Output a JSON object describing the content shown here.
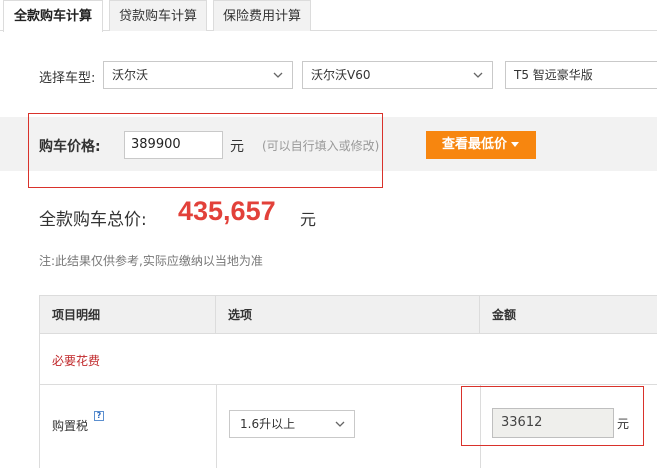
{
  "tabs": [
    {
      "label": "全款购车计算",
      "active": true
    },
    {
      "label": "贷款购车计算",
      "active": false
    },
    {
      "label": "保险费用计算",
      "active": false
    }
  ],
  "model_select": {
    "label": "选择车型:",
    "brand": "沃尔沃",
    "series": "沃尔沃V60",
    "trim": "T5 智远豪华版"
  },
  "price": {
    "label": "购车价格:",
    "value": "389900",
    "unit": "元",
    "hint": "(可以自行填入或修改)",
    "button_label": "查看最低价"
  },
  "total": {
    "label": "全款购车总价:",
    "value": "435,657",
    "unit": "元"
  },
  "note": "注:此结果仅供参考,实际应缴纳以当地为准",
  "table": {
    "headers": [
      "项目明细",
      "选项",
      "金额"
    ],
    "section_label": "必要花费",
    "rows": [
      {
        "item": "购置税",
        "help": "?",
        "option": "1.6升以上",
        "amount": "33612",
        "unit": "元"
      }
    ]
  },
  "colors": {
    "accent_orange": "#f7860f",
    "total_red": "#e2413a",
    "section_red": "#c0282b",
    "highlight_border": "#d9322b"
  },
  "icons": {
    "dropdown": "chevron-down-icon",
    "button_caret": "caret-down-icon",
    "help": "question-icon"
  }
}
